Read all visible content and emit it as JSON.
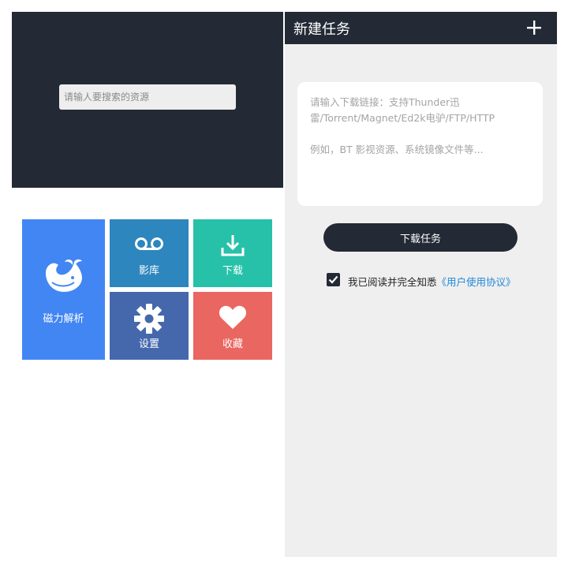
{
  "search": {
    "placeholder": "请输人要搜索的资源"
  },
  "tiles": {
    "magnet": {
      "label": "磁力解析",
      "color": "#4286f3",
      "icon": "whale-icon"
    },
    "library": {
      "label": "影库",
      "color": "#2d86bd",
      "icon": "voicemail-icon"
    },
    "download": {
      "label": "下载",
      "color": "#27c1a9",
      "icon": "download-icon"
    },
    "settings": {
      "label": "设置",
      "color": "#4568ad",
      "icon": "gear-icon"
    },
    "favorites": {
      "label": "收藏",
      "color": "#ea6661",
      "icon": "heart-icon"
    }
  },
  "new_task": {
    "title": "新建任务",
    "add_icon": "plus-icon",
    "link_placeholder": "请输入下载链接：支持Thunder迅雷/Torrent/Magnet/Ed2k电驴/FTP/HTTP\n\n例如，BT 影视资源、系统镜像文件等...",
    "download_button_label": "下载任务",
    "agree_text": "我已阅读并完全知悉",
    "agree_link": "《用户使用协议》",
    "agree_checked": true
  },
  "colors": {
    "header_dark": "#232a35",
    "panel_bg": "#efefef",
    "link_blue": "#1e88d8"
  }
}
